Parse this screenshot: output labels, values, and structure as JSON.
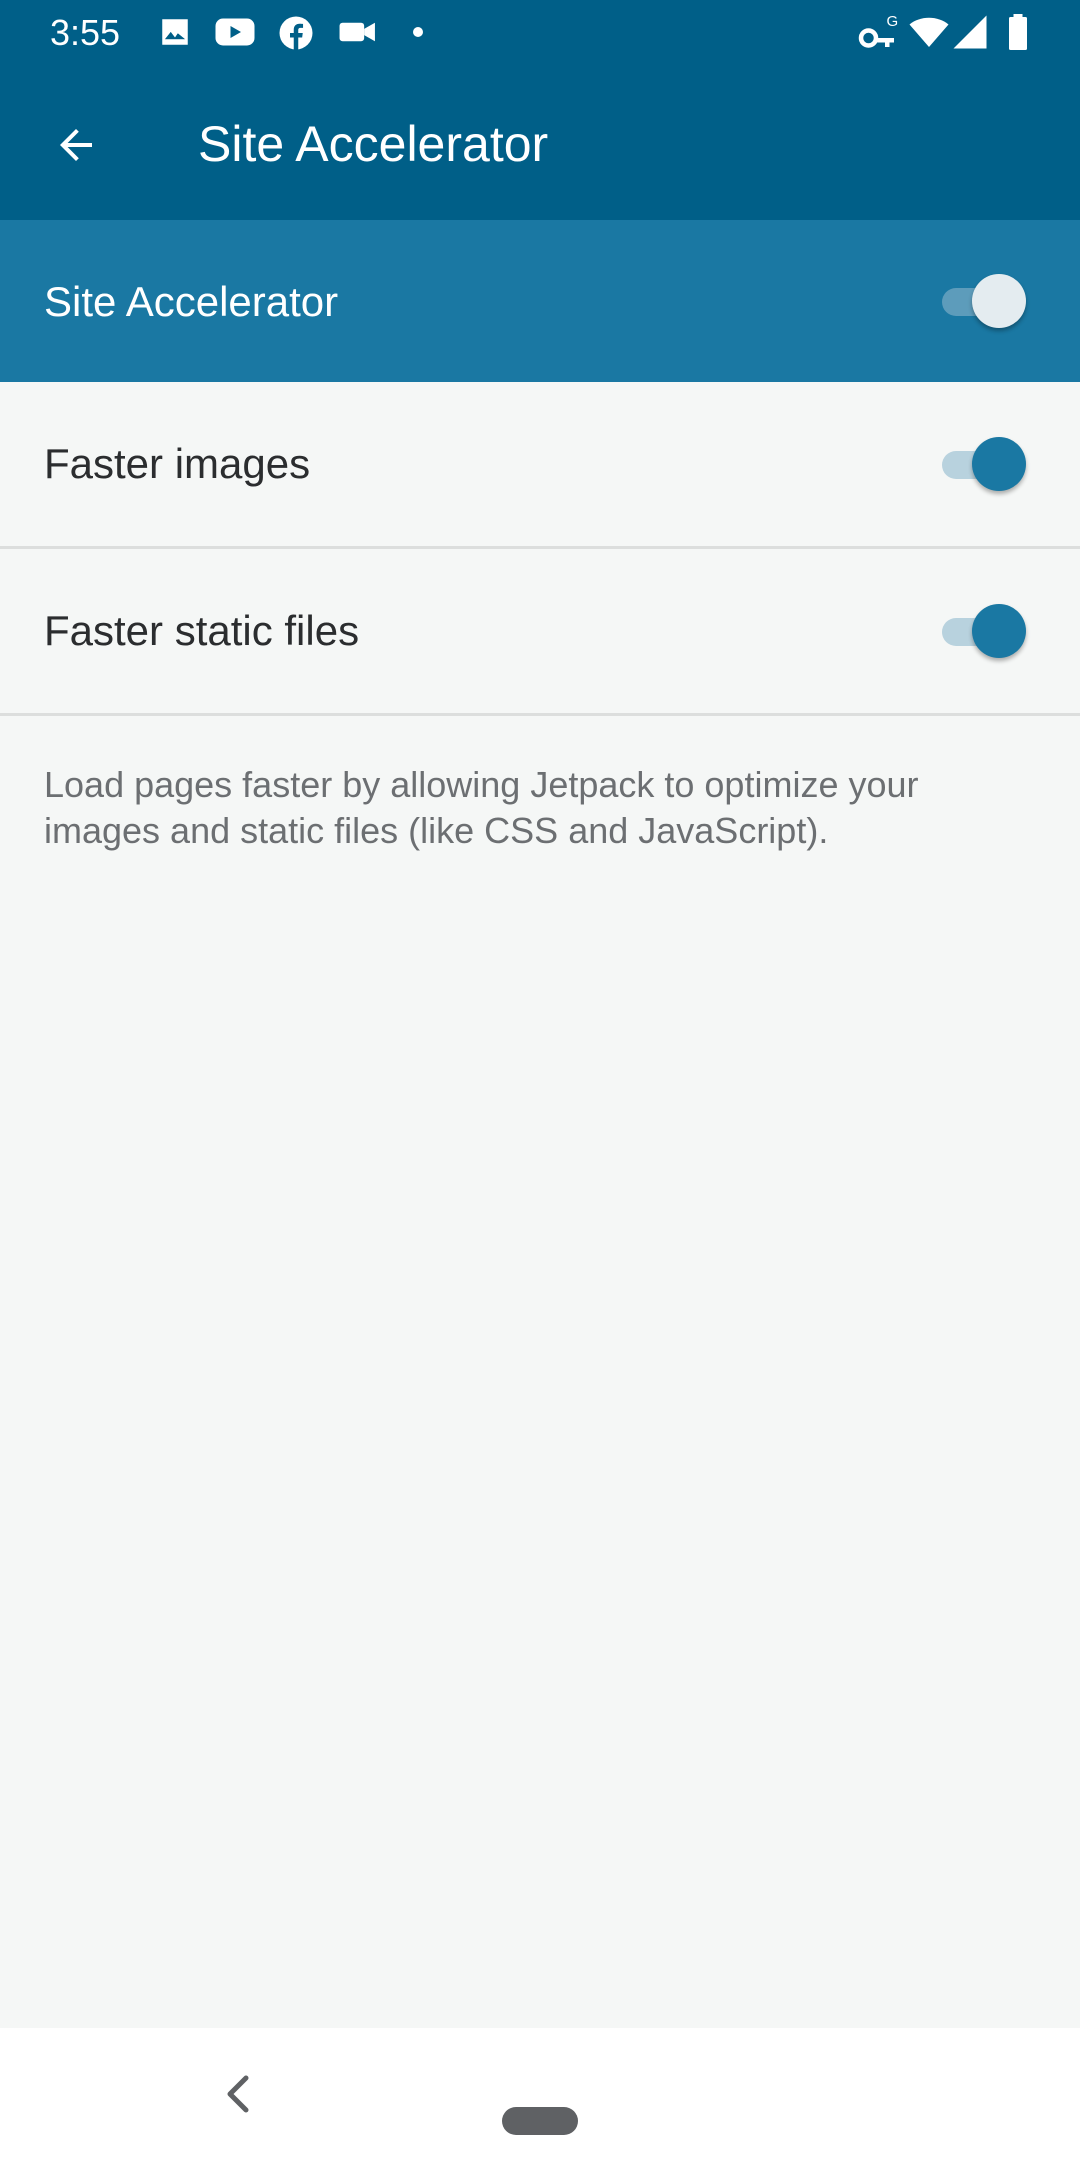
{
  "status_bar": {
    "time": "3:55",
    "left_icons": [
      "image-icon",
      "youtube-icon",
      "facebook-icon",
      "video-camera-icon",
      "dot-icon"
    ],
    "right_icons": [
      "vpn-key-icon",
      "wifi-icon",
      "signal-icon",
      "battery-icon"
    ],
    "key_badge": "G"
  },
  "app_bar": {
    "title": "Site Accelerator",
    "back_icon": "arrow-left-icon"
  },
  "master_toggle": {
    "label": "Site Accelerator",
    "enabled": true
  },
  "settings": [
    {
      "label": "Faster images",
      "enabled": true
    },
    {
      "label": "Faster static files",
      "enabled": true
    }
  ],
  "description": "Load pages faster by allowing Jetpack to optimize your images and static files (like CSS and JavaScript).",
  "colors": {
    "app_bar": "#005f88",
    "accent": "#1a78a3",
    "background": "#f5f7f6"
  },
  "nav_bar": {
    "back_icon": "chevron-left-icon",
    "home_icon": "home-pill-icon"
  }
}
